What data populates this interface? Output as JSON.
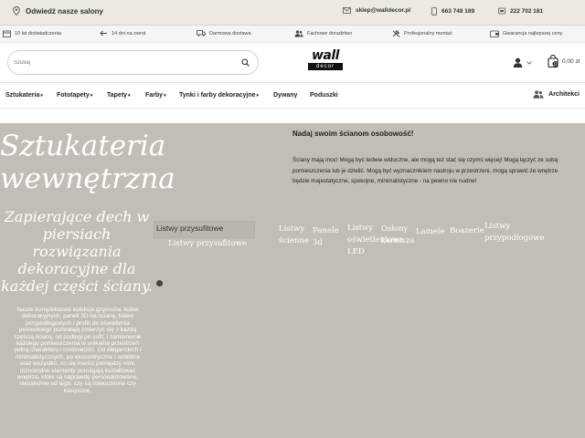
{
  "topbar": {
    "visit_label": "Odwiedź nasze salony",
    "email": "sklep@walldecor.pl",
    "phone_mobile": "663 748 189",
    "phone_landline": "222 702 181"
  },
  "features": [
    {
      "label": "10 lat doświadczenia",
      "icon": "calendar-icon"
    },
    {
      "label": "14 dni na zwrot",
      "icon": "return-arrow-icon"
    },
    {
      "label": "Darmowa dostawa",
      "icon": "truck-icon"
    },
    {
      "label": "Fachowe doradztwo",
      "icon": "people-icon"
    },
    {
      "label": "Profesjonalny montaż",
      "icon": "tools-icon"
    },
    {
      "label": "Gwarancja najlepszej ceny",
      "icon": "wallet-icon"
    }
  ],
  "header": {
    "search_placeholder": "Szukaj",
    "logo_top": "wall",
    "logo_bottom": "decor",
    "cart_count": "0",
    "cart_amount": "0,00 zł"
  },
  "nav": {
    "items": [
      "Sztukateria",
      "Fototapety",
      "Tapety",
      "Farby",
      "Tynki i farby dekoracyjne",
      "Dywany",
      "Poduszki"
    ],
    "architects": "Architekci"
  },
  "hero": {
    "title": "Sztukateria wewnętrzna",
    "subtitle": "Zapierające dech w piersiach rozwiązania dekoracyjne dla każdej części ściany.",
    "description": "Nasze kompleksowe kolekcje gzymsów, listew dekoracyjnych, paneli 3D na ścianę, listew przypodłogowych i profili do oświetlenia pośredniego pozwalają zmierzyć się z każdą częścią ściany, od podłogi po sufit, i zamienienie każdego pomieszczenia w unikalną przestrzeń pełną charakteru i osobowości. Od eleganckich i minimalistycznych, po ekscentryczne i ozdobne oraz wszystko, co się mieści pomiędzy nimi, różnorodne elementy pomagają kształtować wnętrza, które są naprawdę personalizowane, niezależnie od tego, czy są nowoczesne czy klasyczne.",
    "selected_category": "Listwy przysufitowe",
    "categories": [
      "Listwy przysufitowe",
      "Listwy ścienne",
      "Panele 3d",
      "Listwy oświetleniowe LED",
      "Osłony karnisza",
      "Lamele",
      "Boazerie",
      "Listwy przypodłogowe"
    ],
    "right_heading": "Nadaj swoim ścianom osobowość!",
    "right_text": "Ściany mają moc! Mogą być ledwie widoczne, ale mogą też stać się czymś więcej! Mogą łączyć ze sobą pomieszczenia lub je dzielić. Mogą być wyznacznikiem nastroju w przestrzeni, mogą sprawić że wnętrze będzie majestatyczne, spokojne, minimalistyczne - na pewno nie nudne!"
  },
  "colors": {
    "topbar_bg": "#ece8e2",
    "hero_bg": "#c2bdb6",
    "text_dark": "#222222"
  }
}
